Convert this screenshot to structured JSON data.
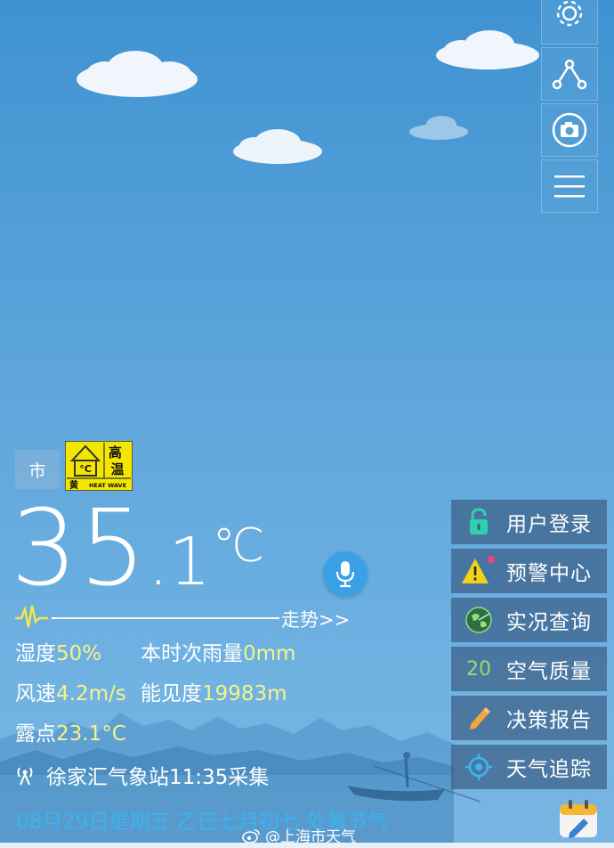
{
  "header": {
    "toolbar": [
      {
        "icon": "gear-icon"
      },
      {
        "icon": "share-icon"
      },
      {
        "icon": "camera-icon"
      },
      {
        "icon": "menu-icon"
      }
    ]
  },
  "weather": {
    "city_chip": "市",
    "warning_badge": {
      "level": "黄",
      "type": "高温",
      "subtitle": "HEAT WAVE",
      "symbol": "°C",
      "color": "#f3e600"
    },
    "temp_int": "35",
    "temp_dec": ".1",
    "temp_unit": "℃",
    "trend_label": "走势>>",
    "humidity_label": "湿度",
    "humidity_value": "50%",
    "rain_label": "本时次雨量",
    "rain_value": "0mm",
    "wind_label": "风速",
    "wind_value": "4.2m/s",
    "visibility_label": "能见度",
    "visibility_value": "19983m",
    "dewpoint_label": "露点",
    "dewpoint_value": "23.1°C",
    "station": "徐家汇气象站11:35采集",
    "date_line": "08月29日星期五  乙巳七月初七  处暑节气"
  },
  "menu": [
    {
      "label": "用户登录",
      "icon": "lock-icon"
    },
    {
      "label": "预警中心",
      "icon": "warning-icon"
    },
    {
      "label": "实况查询",
      "icon": "radar-globe-icon"
    },
    {
      "label": "空气质量",
      "icon": "aqi-value",
      "value": "20"
    },
    {
      "label": "决策报告",
      "icon": "pencil-icon"
    },
    {
      "label": "天气追踪",
      "icon": "target-icon"
    }
  ],
  "watermark": "@上海市天气",
  "colors": {
    "accent": "#39b4f0",
    "value_yellow": "#f5f38a",
    "aqi_green": "#8ce06a"
  }
}
